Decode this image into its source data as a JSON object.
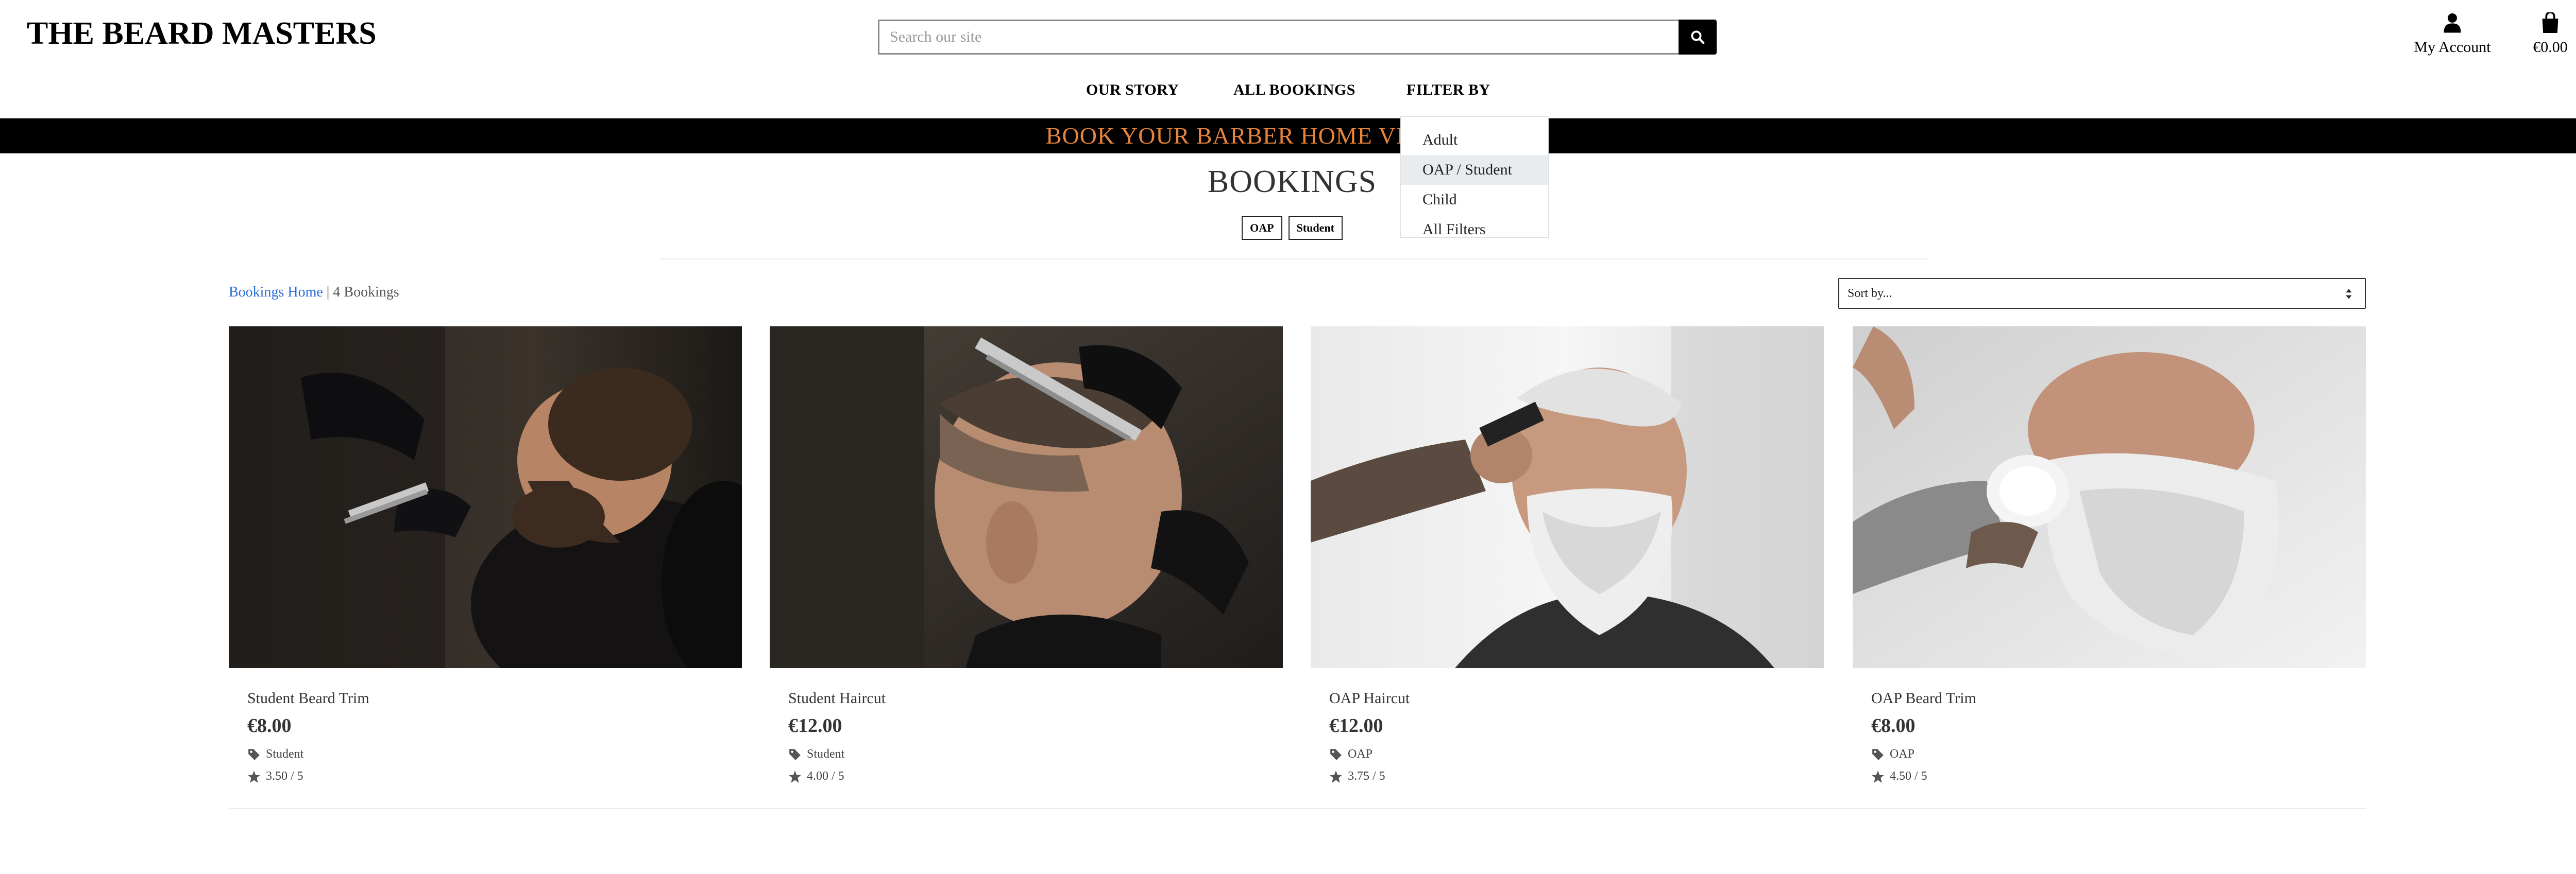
{
  "header": {
    "logo": "THE BEARD MASTERS",
    "search_placeholder": "Search our site",
    "account_label": "My Account",
    "bag_total": "€0.00"
  },
  "nav": {
    "items": [
      "OUR STORY",
      "ALL BOOKINGS",
      "FILTER BY"
    ]
  },
  "banner": {
    "text": "BOOK YOUR BARBER HOME VISIT TODAY!",
    "color": "#e8853b"
  },
  "filter_dropdown": {
    "items": [
      "Adult",
      "OAP / Student",
      "Child",
      "All Filters"
    ],
    "active_index": 1
  },
  "page": {
    "title": "BOOKINGS",
    "active_tags": [
      "OAP",
      "Student"
    ]
  },
  "toolbar": {
    "crumb_link": "Bookings Home",
    "crumb_separator": " | ",
    "count": "4 Bookings",
    "sort_label": "Sort by..."
  },
  "products": [
    {
      "title": "Student Beard Trim",
      "price": "€8.00",
      "category": "Student",
      "rating": "3.50 / 5"
    },
    {
      "title": "Student Haircut",
      "price": "€12.00",
      "category": "Student",
      "rating": "4.00 / 5"
    },
    {
      "title": "OAP Haircut",
      "price": "€12.00",
      "category": "OAP",
      "rating": "3.75 / 5"
    },
    {
      "title": "OAP Beard Trim",
      "price": "€8.00",
      "category": "OAP",
      "rating": "4.50 / 5"
    }
  ],
  "icons": {
    "search": "search-icon",
    "account": "user-icon",
    "bag": "shopping-bag-icon",
    "tag": "tag-icon",
    "rating": "star-icon"
  }
}
